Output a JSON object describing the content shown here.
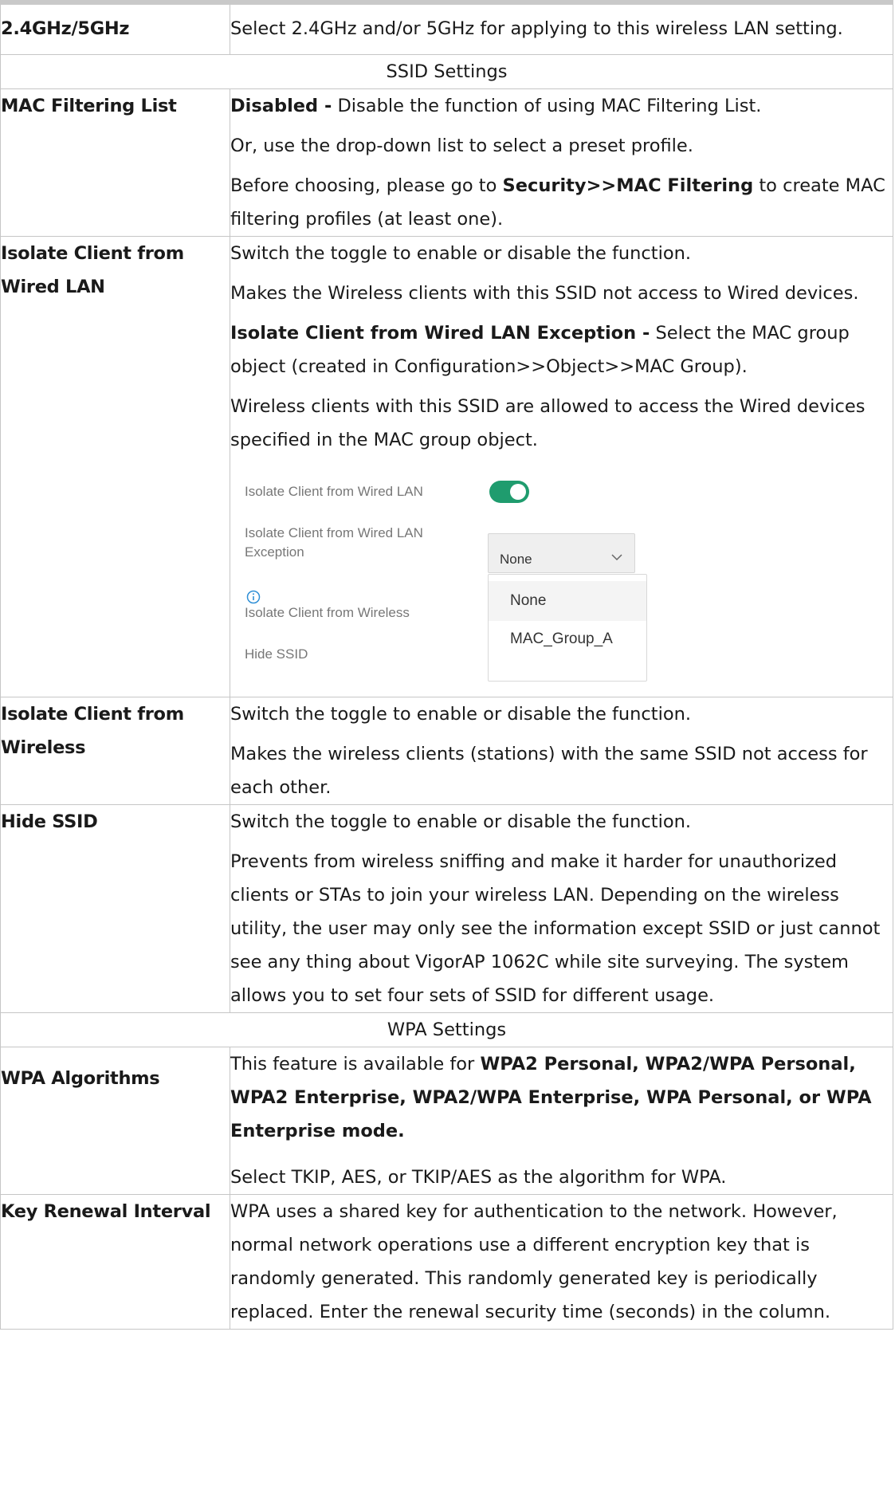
{
  "rows": {
    "band": {
      "label": "2.4GHz/5GHz",
      "desc": "Select 2.4GHz and/or 5GHz for applying to this wireless LAN setting."
    },
    "ssid_section": "SSID Settings",
    "mac_filter": {
      "label": "MAC Filtering List",
      "p1_bold": "Disabled -",
      "p1_text": " Disable the function of using MAC Filtering List.",
      "p2": "Or, use the drop-down list to select a preset profile.",
      "p3_pre": "Before choosing, please go to ",
      "p3_bold": "Security>>MAC Filtering",
      "p3_post": " to create MAC filtering profiles (at least one)."
    },
    "isolate_wired": {
      "label": "Isolate Client from Wired LAN",
      "p1": "Switch the toggle to enable or disable the function.",
      "p2": "Makes the Wireless clients with this SSID not access to Wired devices.",
      "p3_bold": "Isolate Client from Wired LAN Exception -",
      "p3_text": " Select the MAC group object (created in Configuration>>Object>>MAC Group).",
      "p4": "Wireless clients with this SSID are allowed to access the Wired devices specified in the MAC group object."
    },
    "isolate_wireless": {
      "label": "Isolate Client from Wireless",
      "p1": "Switch the toggle to enable or disable the function.",
      "p2": "Makes the wireless clients (stations) with the same SSID not access for each other."
    },
    "hide_ssid": {
      "label": "Hide SSID",
      "p1": "Switch the toggle to enable or disable the function.",
      "p2": "Prevents from wireless sniffing and make it harder for unauthorized clients or STAs to join your wireless LAN. Depending on the wireless utility, the user may only see the information except SSID or just cannot see any thing about VigorAP 1062C while site surveying. The system allows you to set four sets of SSID for different usage."
    },
    "wpa_section": "WPA Settings",
    "wpa_algorithms": {
      "label": "WPA Algorithms",
      "p1_text": "This feature is available for ",
      "p1_bold": "WPA2 Personal, WPA2/WPA Personal, WPA2 Enterprise, WPA2/WPA Enterprise, WPA Personal, or WPA Enterprise mode.",
      "p2": "Select TKIP, AES, or TKIP/AES as the algorithm for WPA."
    },
    "key_renewal": {
      "label": "Key Renewal Interval",
      "p1": "WPA uses a shared key for authentication to the network. However, normal network operations use a different encryption key that is randomly generated. This randomly generated key is periodically replaced. Enter the renewal security time (seconds) in the column."
    }
  },
  "screenshot": {
    "isolate_wired_label": "Isolate Client from Wired LAN",
    "isolate_wired_toggle": "on",
    "exception_label_line1": "Isolate Client from Wired LAN",
    "exception_label_line2": "Exception",
    "exception_selected": "None",
    "isolate_wireless_label": "Isolate Client from Wireless",
    "hide_ssid_label": "Hide SSID",
    "dropdown_options": [
      "None",
      "MAC_Group_A"
    ],
    "icons": {
      "info": "info-icon",
      "chevron": "chevron-down-icon"
    },
    "colors": {
      "toggle_on": "#1f9c6e",
      "info": "#2f8fd6"
    }
  }
}
